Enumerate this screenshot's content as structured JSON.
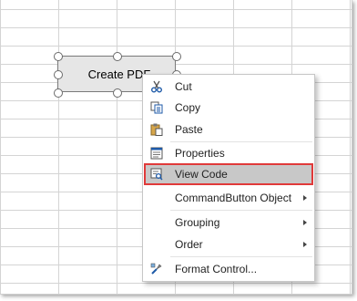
{
  "control": {
    "label": "Create PDF"
  },
  "context_menu": {
    "items": [
      {
        "label": "Cut",
        "icon": "scissors-icon"
      },
      {
        "label": "Copy",
        "icon": "copy-icon"
      },
      {
        "label": "Paste",
        "icon": "paste-icon"
      },
      {
        "label": "Properties",
        "icon": "properties-icon"
      },
      {
        "label": "View Code",
        "icon": "view-code-icon",
        "highlighted": true
      },
      {
        "label": "CommandButton Object",
        "submenu": true
      },
      {
        "label": "Grouping",
        "submenu": true
      },
      {
        "label": "Order",
        "submenu": true
      },
      {
        "label": "Format Control...",
        "icon": "format-control-icon"
      }
    ]
  },
  "colors": {
    "highlight_border": "#e03a3a",
    "highlight_fill": "#c8c8c8"
  }
}
